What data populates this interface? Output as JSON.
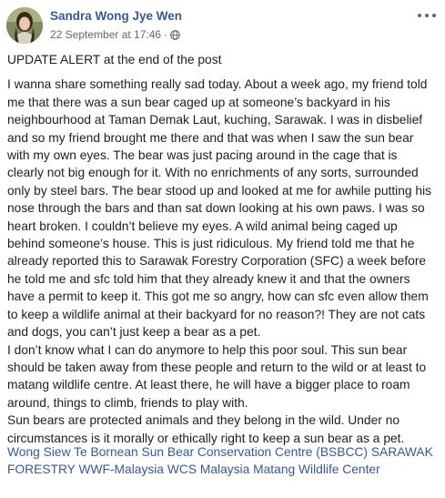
{
  "post": {
    "author": "Sandra Wong Jye Wen",
    "timestamp": "22 September at 17:46",
    "separator": "·",
    "privacy_icon": "globe-icon",
    "more_icon": "more-options-icon",
    "update_line": "UPDATE ALERT at the end of the post",
    "body": "I wanna share something really sad today. About a week ago, my friend told me that there was a sun bear caged up at someone’s backyard in his neighbourhood at Taman Demak Laut, kuching, Sarawak. I was in disbelief and so my friend brought me there and that was when I saw the sun bear with my own eyes. The bear was just pacing around in the cage that is clearly not big enough for it. With no enrichments of any sorts, surrounded only by steel bars. The bear stood up and looked at me for awhile putting his nose through the bars and than sat down looking at his own paws. I was so heart broken. I couldn’t believe my eyes. A wild animal being caged up behind someone’s house. This is just ridiculous. My friend told me that he already reported this to Sarawak Forestry Corporation (SFC) a week before he told me and sfc told him that they already knew it and that the owners have a permit to keep it. This got me so angry, how can sfc even allow them to keep a wildlife animal at their backyard for no reason?! They are not cats and dogs, you can’t just keep a bear as a pet.\nI don’t know what I can do anymore to help this poor soul. This sun bear should be taken away from these people and return to the wild or at least to matang wildlife centre. At least there, he will have a bigger place to roam around, things to climb, friends to play with.\nSun bears are protected animals and they belong in the wild. Under no circumstances is it morally or ethically right to keep a sun bear as a pet.",
    "tags": [
      "Wong Siew Te",
      "Bornean Sun Bear Conservation Centre (BSBCC)",
      "SARAWAK FORESTRY",
      "WWF-Malaysia",
      "WCS Malaysia",
      "Matang Wildlife Center"
    ]
  },
  "colors": {
    "link": "#385898",
    "text": "#1c1e21",
    "meta": "#616770"
  }
}
